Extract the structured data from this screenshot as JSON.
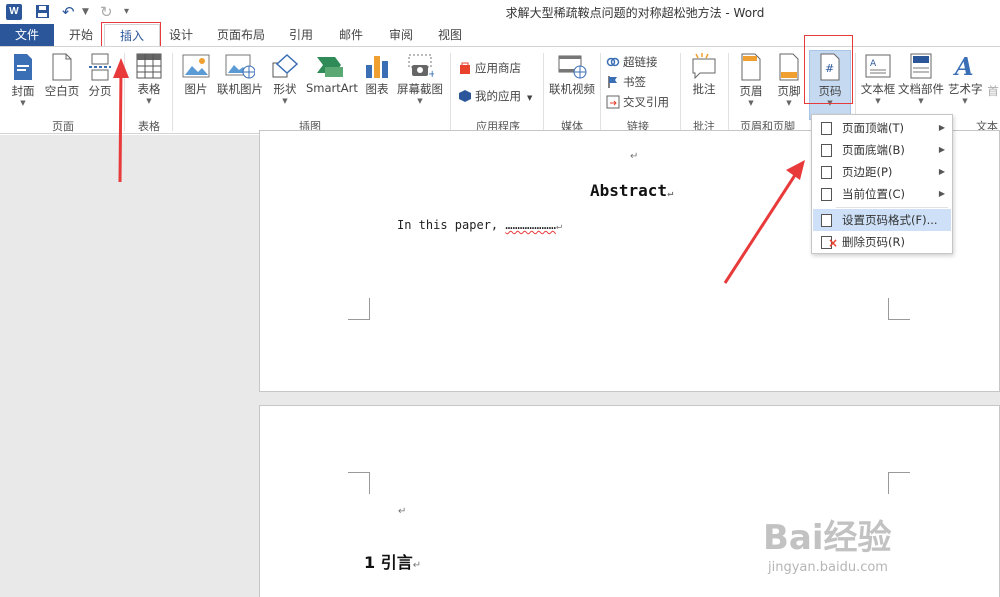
{
  "app": {
    "window_title": "求解大型稀疏鞍点问题的对称超松弛方法 - Word",
    "logo": "W"
  },
  "tabs": [
    "文件",
    "开始",
    "插入",
    "设计",
    "页面布局",
    "引用",
    "邮件",
    "审阅",
    "视图"
  ],
  "ribbon": {
    "groups": {
      "pages": "页面",
      "tables": "表格",
      "illustrations": "插图",
      "apps": "应用程序",
      "media": "媒体",
      "links": "链接",
      "comments": "批注",
      "header_footer": "页眉和页脚",
      "text": "文本"
    },
    "buttons": {
      "cover": "封面",
      "blank_page": "空白页",
      "page_break": "分页",
      "table": "表格",
      "picture": "图片",
      "online_picture": "联机图片",
      "shapes": "形状",
      "smartart": "SmartArt",
      "chart": "图表",
      "screenshot": "屏幕截图",
      "store": "应用商店",
      "my_apps": "我的应用",
      "online_video": "联机视频",
      "hyperlink": "超链接",
      "bookmark": "书签",
      "cross_ref": "交叉引用",
      "comment": "批注",
      "header": "页眉",
      "footer": "页脚",
      "page_number": "页码",
      "textbox": "文本框",
      "quick_parts": "文档部件",
      "wordart": "艺术字",
      "dropcap": "首"
    }
  },
  "page_number_menu": [
    {
      "label": "页面顶端(T)",
      "submenu": true
    },
    {
      "label": "页面底端(B)",
      "submenu": true
    },
    {
      "label": "页边距(P)",
      "submenu": true
    },
    {
      "label": "当前位置(C)",
      "submenu": true
    },
    {
      "label": "设置页码格式(F)...",
      "submenu": false
    },
    {
      "label": "删除页码(R)",
      "submenu": false
    }
  ],
  "document": {
    "para_mark": "↵",
    "abstract_title": "Abstract",
    "body_text": "In this paper, ",
    "body_dots": "…………………",
    "heading": "1  引言"
  },
  "watermark": {
    "brand": "Bai经验",
    "url": "jingyan.baidu.com"
  },
  "colors": {
    "accent": "#2b579a",
    "annotation_red": "#e83a3a",
    "highlight": "#cde0f7"
  }
}
